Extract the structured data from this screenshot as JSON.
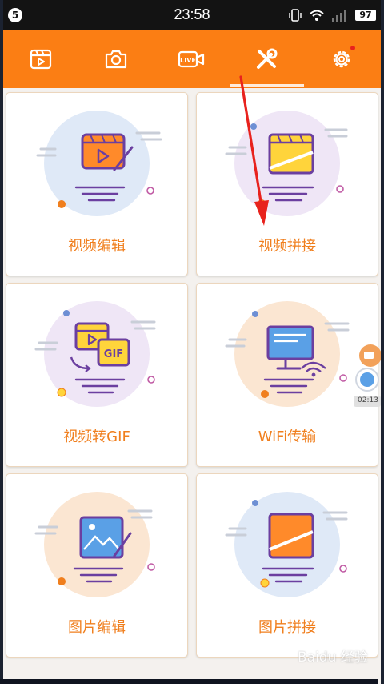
{
  "status_bar": {
    "badge": "5",
    "time": "23:58",
    "battery": "97"
  },
  "toolbar": {
    "tabs": [
      {
        "icon": "video-clip-icon"
      },
      {
        "icon": "camera-icon"
      },
      {
        "icon": "live-icon",
        "label": "LIVE"
      },
      {
        "icon": "tools-icon",
        "selected": true
      },
      {
        "icon": "settings-icon",
        "badge": true
      }
    ],
    "accent_color": "#fb7e14"
  },
  "cards": [
    {
      "label": "视频编辑",
      "icon": "video-edit-icon"
    },
    {
      "label": "视频拼接",
      "icon": "video-stitch-icon"
    },
    {
      "label": "视频转GIF",
      "icon": "video-to-gif-icon",
      "gif_text": "GIF"
    },
    {
      "label": "WiFi传输",
      "icon": "wifi-transfer-icon"
    },
    {
      "label": "图片编辑",
      "icon": "image-edit-icon"
    },
    {
      "label": "图片拼接",
      "icon": "image-stitch-icon"
    }
  ],
  "floating_recorder": {
    "time": "02:13"
  },
  "watermark": "Baidu 经验"
}
